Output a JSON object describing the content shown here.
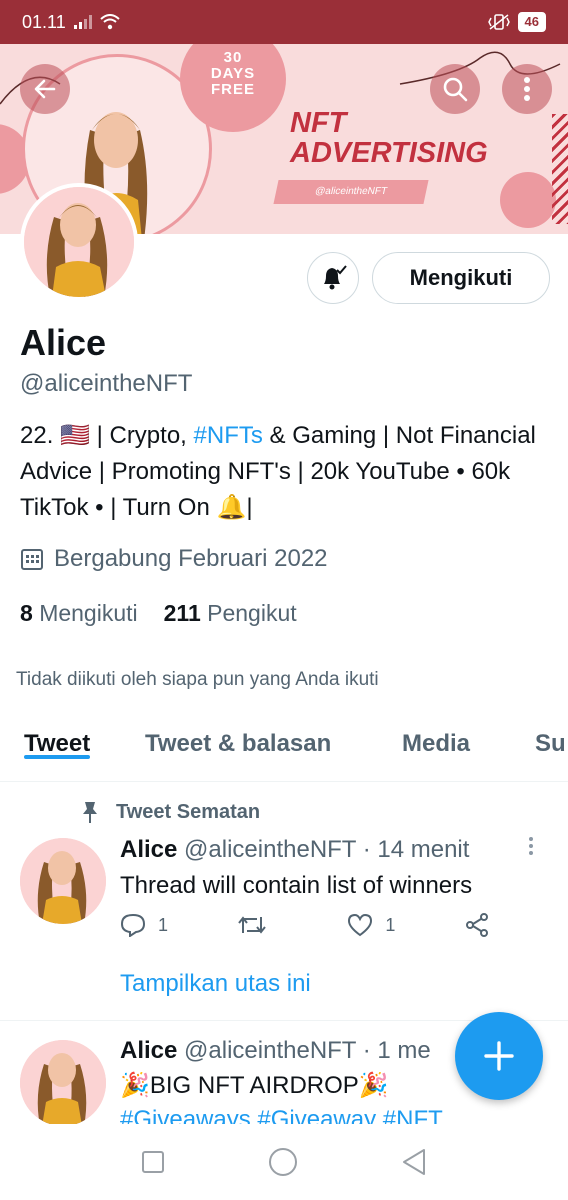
{
  "status": {
    "time": "01.11",
    "battery": "46"
  },
  "banner": {
    "badge_line1": "30",
    "badge_line2": "DAYS",
    "badge_line3": "FREE",
    "title_line1": "NFT",
    "title_line2": "ADVERTISING",
    "tag": "@aliceintheNFT"
  },
  "profile": {
    "follow_button": "Mengikuti",
    "name": "Alice",
    "handle": "@aliceintheNFT",
    "bio_part1": "22. 🇺🇸 | Crypto, ",
    "bio_hashtag": "#NFTs",
    "bio_part2": " & Gaming | Not Financial Advice | Promoting NFT's | 20k YouTube • 60k TikTok • | Turn On 🔔|",
    "joined": "Bergabung Februari 2022",
    "following_count": "8",
    "following_label": "Mengikuti",
    "followers_count": "211",
    "followers_label": "Pengikut",
    "not_followed": "Tidak diikuti oleh siapa pun yang Anda ikuti"
  },
  "tabs": [
    {
      "label": "Tweet",
      "active": true
    },
    {
      "label": "Tweet & balasan",
      "active": false
    },
    {
      "label": "Media",
      "active": false
    },
    {
      "label": "Su",
      "active": false
    }
  ],
  "tweets": [
    {
      "pinned_label": "Tweet Sematan",
      "name": "Alice",
      "handle": "@aliceintheNFT",
      "time": "· 14 menit",
      "text": "Thread will contain list of winners",
      "replies": "1",
      "likes": "1",
      "show_thread": "Tampilkan utas ini"
    },
    {
      "name": "Alice",
      "handle": "@aliceintheNFT",
      "time": "· 1 me",
      "text": "🎉BIG NFT AIRDROP🎉",
      "hashtags": "#Giveaways #Giveaway #NFT"
    }
  ],
  "colors": {
    "accent": "#1d9bf0",
    "status_bar": "#9a2f38",
    "banner_pink": "#ec9aa0",
    "banner_red": "#c2313f"
  }
}
